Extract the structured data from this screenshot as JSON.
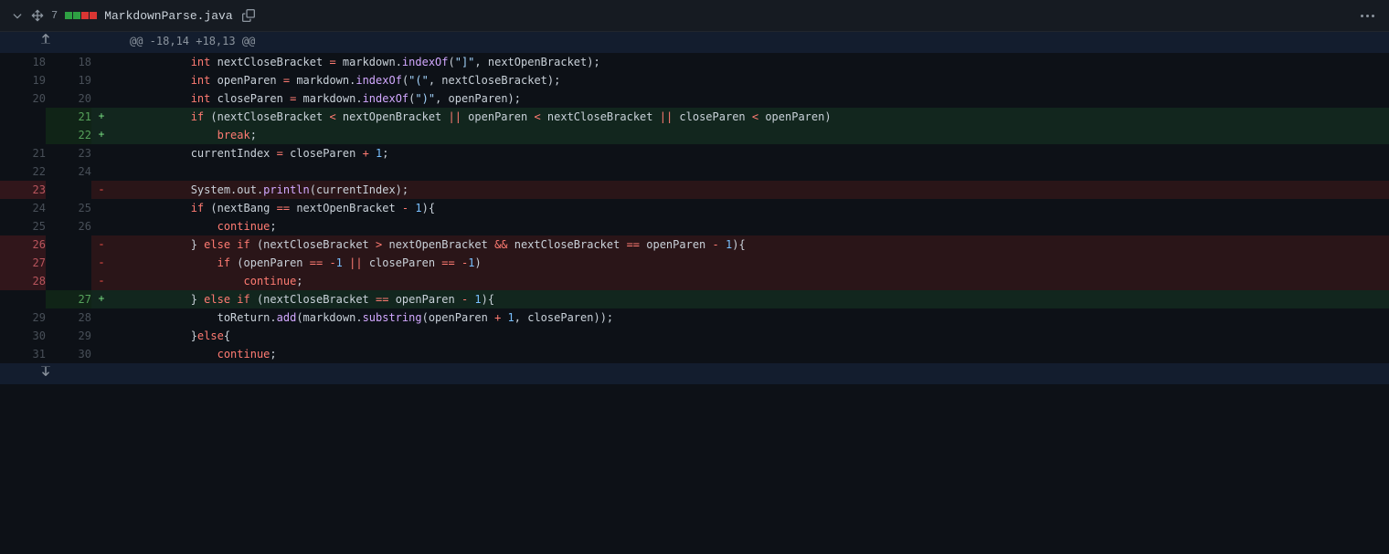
{
  "header": {
    "change_count": "7",
    "filename": "MarkdownParse.java",
    "diffstat": {
      "add": 2,
      "del": 2
    }
  },
  "hunk_header": "@@ -18,14 +18,13 @@",
  "lines": [
    {
      "type": "context",
      "old": "18",
      "new": "18",
      "tokens": [
        [
          "pad",
          "            "
        ],
        [
          "type",
          "int"
        ],
        [
          "plain",
          " nextCloseBracket "
        ],
        [
          "op",
          "="
        ],
        [
          "plain",
          " markdown."
        ],
        [
          "fn",
          "indexOf"
        ],
        [
          "plain",
          "("
        ],
        [
          "str",
          "\"]\""
        ],
        [
          "plain",
          ", nextOpenBracket);"
        ]
      ]
    },
    {
      "type": "context",
      "old": "19",
      "new": "19",
      "tokens": [
        [
          "pad",
          "            "
        ],
        [
          "type",
          "int"
        ],
        [
          "plain",
          " openParen "
        ],
        [
          "op",
          "="
        ],
        [
          "plain",
          " markdown."
        ],
        [
          "fn",
          "indexOf"
        ],
        [
          "plain",
          "("
        ],
        [
          "str",
          "\"(\""
        ],
        [
          "plain",
          ", nextCloseBracket);"
        ]
      ]
    },
    {
      "type": "context",
      "old": "20",
      "new": "20",
      "tokens": [
        [
          "pad",
          "            "
        ],
        [
          "type",
          "int"
        ],
        [
          "plain",
          " closeParen "
        ],
        [
          "op",
          "="
        ],
        [
          "plain",
          " markdown."
        ],
        [
          "fn",
          "indexOf"
        ],
        [
          "plain",
          "("
        ],
        [
          "str",
          "\")\""
        ],
        [
          "plain",
          ", openParen);"
        ]
      ]
    },
    {
      "type": "add",
      "old": "",
      "new": "21",
      "tokens": [
        [
          "pad",
          "            "
        ],
        [
          "kw",
          "if"
        ],
        [
          "plain",
          " (nextCloseBracket "
        ],
        [
          "op",
          "<"
        ],
        [
          "plain",
          " nextOpenBracket "
        ],
        [
          "op",
          "||"
        ],
        [
          "plain",
          " openParen "
        ],
        [
          "op",
          "<"
        ],
        [
          "plain",
          " nextCloseBracket "
        ],
        [
          "op",
          "||"
        ],
        [
          "plain",
          " closeParen "
        ],
        [
          "op",
          "<"
        ],
        [
          "plain",
          " openParen)"
        ]
      ]
    },
    {
      "type": "add",
      "old": "",
      "new": "22",
      "tokens": [
        [
          "pad",
          "                "
        ],
        [
          "kw",
          "break"
        ],
        [
          "plain",
          ";"
        ]
      ]
    },
    {
      "type": "context",
      "old": "21",
      "new": "23",
      "tokens": [
        [
          "pad",
          "            "
        ],
        [
          "plain",
          "currentIndex "
        ],
        [
          "op",
          "="
        ],
        [
          "plain",
          " closeParen "
        ],
        [
          "op",
          "+"
        ],
        [
          "plain",
          " "
        ],
        [
          "num",
          "1"
        ],
        [
          "plain",
          ";"
        ]
      ]
    },
    {
      "type": "context",
      "old": "22",
      "new": "24",
      "tokens": [
        [
          "plain",
          ""
        ]
      ]
    },
    {
      "type": "del",
      "old": "23",
      "new": "",
      "tokens": [
        [
          "pad",
          "            "
        ],
        [
          "plain",
          "System.out."
        ],
        [
          "fn",
          "println"
        ],
        [
          "plain",
          "(currentIndex);"
        ]
      ]
    },
    {
      "type": "context",
      "old": "24",
      "new": "25",
      "tokens": [
        [
          "pad",
          "            "
        ],
        [
          "kw",
          "if"
        ],
        [
          "plain",
          " (nextBang "
        ],
        [
          "op",
          "=="
        ],
        [
          "plain",
          " nextOpenBracket "
        ],
        [
          "op",
          "-"
        ],
        [
          "plain",
          " "
        ],
        [
          "num",
          "1"
        ],
        [
          "plain",
          "){"
        ]
      ]
    },
    {
      "type": "context",
      "old": "25",
      "new": "26",
      "tokens": [
        [
          "pad",
          "                "
        ],
        [
          "kw",
          "continue"
        ],
        [
          "plain",
          ";"
        ]
      ]
    },
    {
      "type": "del",
      "old": "26",
      "new": "",
      "tokens": [
        [
          "pad",
          "            "
        ],
        [
          "plain",
          "} "
        ],
        [
          "kw",
          "else if"
        ],
        [
          "plain",
          " (nextCloseBracket "
        ],
        [
          "op",
          ">"
        ],
        [
          "plain",
          " nextOpenBracket "
        ],
        [
          "op",
          "&&"
        ],
        [
          "plain",
          " nextCloseBracket "
        ],
        [
          "op",
          "=="
        ],
        [
          "plain",
          " openParen "
        ],
        [
          "op",
          "-"
        ],
        [
          "plain",
          " "
        ],
        [
          "num",
          "1"
        ],
        [
          "plain",
          "){"
        ]
      ]
    },
    {
      "type": "del",
      "old": "27",
      "new": "",
      "tokens": [
        [
          "pad",
          "                "
        ],
        [
          "kw",
          "if"
        ],
        [
          "plain",
          " (openParen "
        ],
        [
          "op",
          "=="
        ],
        [
          "plain",
          " "
        ],
        [
          "op",
          "-"
        ],
        [
          "num",
          "1"
        ],
        [
          "plain",
          " "
        ],
        [
          "op",
          "||"
        ],
        [
          "plain",
          " closeParen "
        ],
        [
          "op",
          "=="
        ],
        [
          "plain",
          " "
        ],
        [
          "op",
          "-"
        ],
        [
          "num",
          "1"
        ],
        [
          "plain",
          ")"
        ]
      ]
    },
    {
      "type": "del",
      "old": "28",
      "new": "",
      "tokens": [
        [
          "pad",
          "                    "
        ],
        [
          "kw",
          "continue"
        ],
        [
          "plain",
          ";"
        ]
      ]
    },
    {
      "type": "add",
      "old": "",
      "new": "27",
      "tokens": [
        [
          "pad",
          "            "
        ],
        [
          "plain",
          "} "
        ],
        [
          "kw",
          "else if"
        ],
        [
          "plain",
          " (nextCloseBracket "
        ],
        [
          "op",
          "=="
        ],
        [
          "plain",
          " openParen "
        ],
        [
          "op",
          "-"
        ],
        [
          "plain",
          " "
        ],
        [
          "num",
          "1"
        ],
        [
          "plain",
          "){"
        ]
      ]
    },
    {
      "type": "context",
      "old": "29",
      "new": "28",
      "tokens": [
        [
          "pad",
          "                "
        ],
        [
          "plain",
          "toReturn."
        ],
        [
          "fn",
          "add"
        ],
        [
          "plain",
          "(markdown."
        ],
        [
          "fn",
          "substring"
        ],
        [
          "plain",
          "(openParen "
        ],
        [
          "op",
          "+"
        ],
        [
          "plain",
          " "
        ],
        [
          "num",
          "1"
        ],
        [
          "plain",
          ", closeParen));"
        ]
      ]
    },
    {
      "type": "context",
      "old": "30",
      "new": "29",
      "tokens": [
        [
          "pad",
          "            "
        ],
        [
          "plain",
          "}"
        ],
        [
          "kw",
          "else"
        ],
        [
          "plain",
          "{"
        ]
      ]
    },
    {
      "type": "context",
      "old": "31",
      "new": "30",
      "tokens": [
        [
          "pad",
          "                "
        ],
        [
          "kw",
          "continue"
        ],
        [
          "plain",
          ";"
        ]
      ]
    }
  ]
}
